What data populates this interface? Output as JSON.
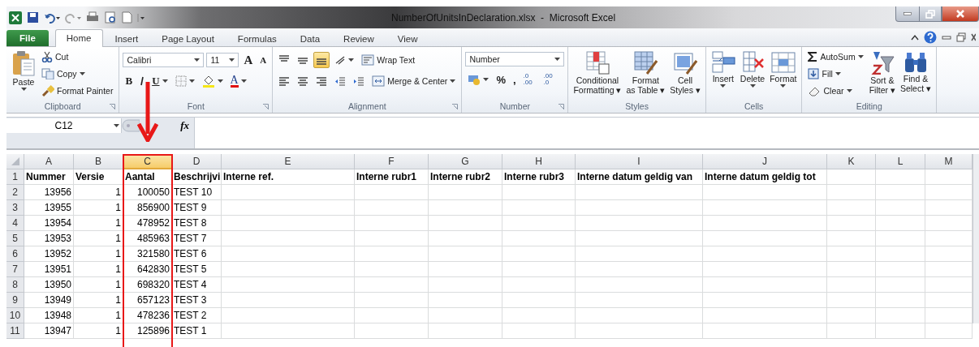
{
  "window": {
    "title": "NumberOfUnitsInDeclaration.xlsx  -  Microsoft Excel"
  },
  "tabs": [
    {
      "label": "File",
      "kind": "file",
      "selected": false
    },
    {
      "label": "Home",
      "kind": "tab",
      "selected": true
    },
    {
      "label": "Insert",
      "kind": "tab",
      "selected": false
    },
    {
      "label": "Page Layout",
      "kind": "tab",
      "selected": false
    },
    {
      "label": "Formulas",
      "kind": "tab",
      "selected": false
    },
    {
      "label": "Data",
      "kind": "tab",
      "selected": false
    },
    {
      "label": "Review",
      "kind": "tab",
      "selected": false
    },
    {
      "label": "View",
      "kind": "tab",
      "selected": false
    }
  ],
  "ribbon": {
    "groups": [
      {
        "label": "Clipboard",
        "launcher": true,
        "items": [
          {
            "kind": "large",
            "lines": [
              "Paste"
            ],
            "dropdown": true
          },
          {
            "kind": "stack",
            "items": [
              {
                "kind": "small",
                "label": "Cut"
              },
              {
                "kind": "small",
                "label": "Copy",
                "dropdown": true
              },
              {
                "kind": "small",
                "label": "Format Painter"
              }
            ]
          }
        ]
      },
      {
        "label": "Font",
        "launcher": true,
        "items": [
          {
            "kind": "rows",
            "rows": [
              [
                {
                  "kind": "combo",
                  "value": "Calibri"
                },
                {
                  "kind": "combo",
                  "value": "11"
                },
                {
                  "kind": "small",
                  "label": "A"
                },
                {
                  "kind": "small",
                  "label": "A"
                }
              ],
              [
                {
                  "kind": "small",
                  "label": "B"
                },
                {
                  "kind": "small"
                },
                {
                  "kind": "small",
                  "label": "U",
                  "dropdown": true
                },
                {
                  "kind": "small",
                  "dropdown": true
                },
                {
                  "kind": "small",
                  "dropdown": true
                },
                {
                  "kind": "small",
                  "label": "A",
                  "dropdown": true
                }
              ]
            ]
          }
        ]
      },
      {
        "label": "Alignment",
        "launcher": true,
        "items": [
          {
            "kind": "rows",
            "rows": [
              [
                {
                  "kind": "small",
                  "on": false
                },
                {
                  "kind": "small",
                  "on": false
                },
                {
                  "kind": "small",
                  "on": true
                },
                {
                  "kind": "small",
                  "dropdown": true
                },
                {
                  "kind": "small",
                  "label": "Wrap Text"
                }
              ],
              [
                {
                  "kind": "small"
                },
                {
                  "kind": "small"
                },
                {
                  "kind": "small"
                },
                {
                  "kind": "small"
                },
                {
                  "kind": "small"
                },
                {
                  "kind": "small",
                  "label": "Merge & Center",
                  "dropdown": true
                }
              ]
            ]
          }
        ]
      },
      {
        "label": "Number",
        "launcher": true,
        "items": [
          {
            "kind": "rows",
            "rows": [
              [
                {
                  "kind": "combo",
                  "value": "Number"
                }
              ],
              [
                {
                  "kind": "small",
                  "dropdown": true
                },
                {
                  "kind": "small",
                  "label": "%"
                },
                {
                  "kind": "small",
                  "label": ","
                },
                {
                  "kind": "small",
                  "label": ".0 .00"
                },
                {
                  "kind": "small",
                  "label": ".00 .0"
                }
              ]
            ]
          }
        ]
      },
      {
        "label": "Styles",
        "items": [
          {
            "kind": "large",
            "lines": [
              "Conditional",
              "Formatting ▾"
            ]
          },
          {
            "kind": "large",
            "lines": [
              "Format",
              "as Table ▾"
            ]
          },
          {
            "kind": "large",
            "lines": [
              "Cell",
              "Styles ▾"
            ]
          }
        ]
      },
      {
        "label": "Cells",
        "items": [
          {
            "kind": "large",
            "lines": [
              "Insert"
            ],
            "dropdown": true
          },
          {
            "kind": "large",
            "lines": [
              "Delete"
            ],
            "dropdown": true
          },
          {
            "kind": "large",
            "lines": [
              "Format"
            ],
            "dropdown": true
          }
        ]
      },
      {
        "label": "Editing",
        "items": [
          {
            "kind": "stack",
            "items": [
              {
                "kind": "small",
                "label": "AutoSum",
                "dropdown": true
              },
              {
                "kind": "small",
                "label": "Fill",
                "dropdown": true
              },
              {
                "kind": "small",
                "label": "Clear",
                "dropdown": true
              }
            ]
          },
          {
            "kind": "large",
            "lines": [
              "Sort &",
              "Filter ▾"
            ]
          },
          {
            "kind": "large",
            "lines": [
              "Find &",
              "Select ▾"
            ]
          }
        ]
      }
    ]
  },
  "formula_bar": {
    "name_box": "C12",
    "function_label": "fx"
  },
  "sheet": {
    "columns": [
      {
        "letter": "A",
        "numeric": true,
        "selected": false,
        "outlined": false
      },
      {
        "letter": "B",
        "numeric": true,
        "selected": false,
        "outlined": false
      },
      {
        "letter": "C",
        "numeric": true,
        "selected": true,
        "outlined": true
      },
      {
        "letter": "D",
        "numeric": false,
        "selected": false,
        "outlined": false
      },
      {
        "letter": "E",
        "selected": false,
        "outlined": false
      },
      {
        "letter": "F",
        "selected": false,
        "outlined": false
      },
      {
        "letter": "G",
        "selected": false,
        "outlined": false
      },
      {
        "letter": "H",
        "selected": false,
        "outlined": false
      },
      {
        "letter": "I",
        "selected": false,
        "outlined": false
      },
      {
        "letter": "J",
        "selected": false,
        "outlined": false
      },
      {
        "letter": "K",
        "selected": false,
        "outlined": false
      },
      {
        "letter": "L",
        "selected": false,
        "outlined": false
      },
      {
        "letter": "M",
        "selected": false,
        "outlined": false
      }
    ],
    "header_row": {
      "number": "1",
      "cells": [
        "Nummer",
        "Versie",
        "Aantal",
        "Beschrijvi",
        "Interne ref.",
        "Interne rubr1",
        "Interne rubr2",
        "Interne rubr3",
        "Interne datum geldig van",
        "Interne datum geldig tot"
      ]
    },
    "rows": [
      {
        "number": "2",
        "cells": [
          "13956",
          "1",
          "100050",
          "TEST 10"
        ]
      },
      {
        "number": "3",
        "cells": [
          "13955",
          "1",
          "856900",
          "TEST 9"
        ]
      },
      {
        "number": "4",
        "cells": [
          "13954",
          "1",
          "478952",
          "TEST 8"
        ]
      },
      {
        "number": "5",
        "cells": [
          "13953",
          "1",
          "485963",
          "TEST 7"
        ]
      },
      {
        "number": "6",
        "cells": [
          "13952",
          "1",
          "321580",
          "TEST 6"
        ]
      },
      {
        "number": "7",
        "cells": [
          "13951",
          "1",
          "642830",
          "TEST 5"
        ]
      },
      {
        "number": "8",
        "cells": [
          "13950",
          "1",
          "698320",
          "TEST 4"
        ]
      },
      {
        "number": "9",
        "cells": [
          "13949",
          "1",
          "657123",
          "TEST 3"
        ]
      },
      {
        "number": "10",
        "cells": [
          "13948",
          "1",
          "478236",
          "TEST 2"
        ]
      },
      {
        "number": "11",
        "cells": [
          "13947",
          "1",
          "125896",
          "TEST 1"
        ]
      }
    ]
  }
}
